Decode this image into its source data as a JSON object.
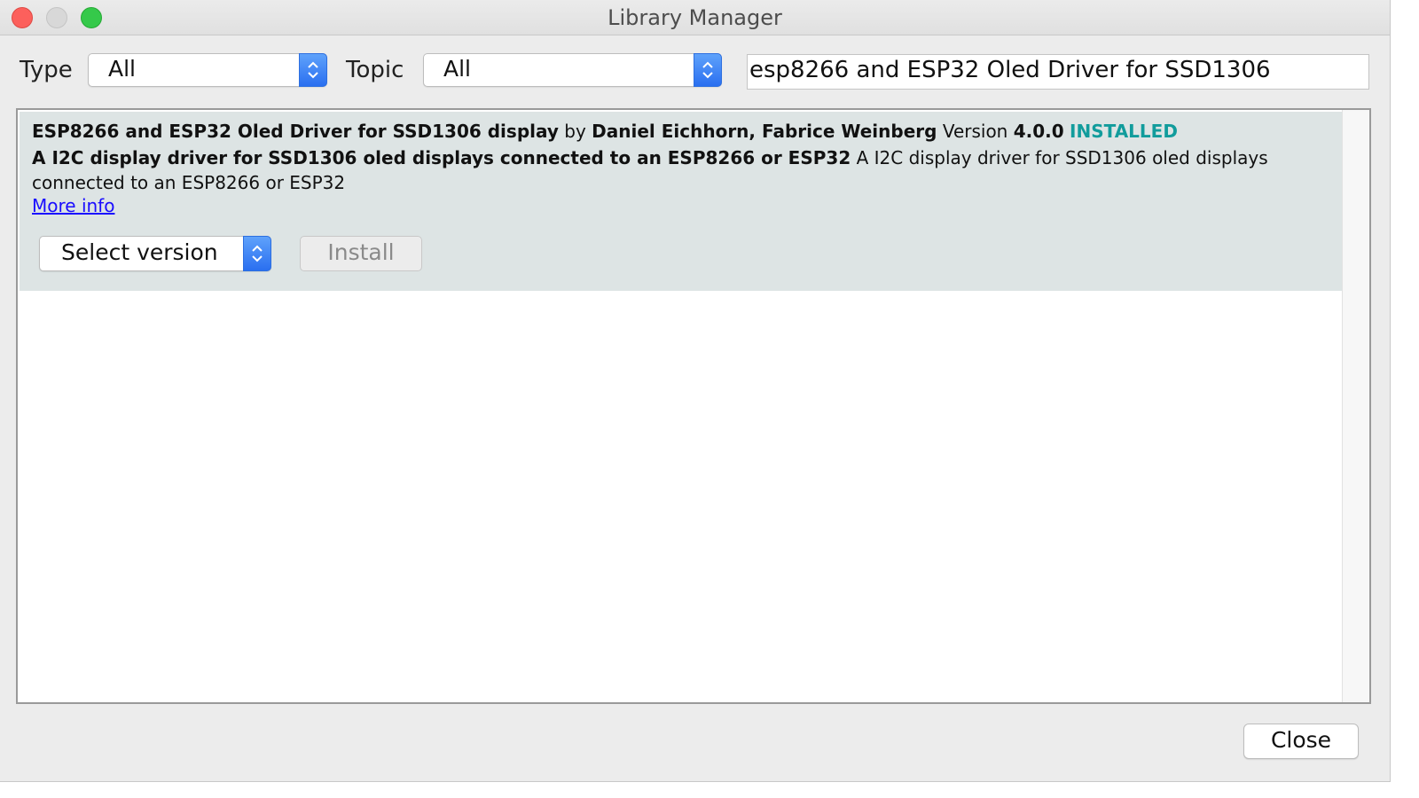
{
  "window": {
    "title": "Library Manager"
  },
  "filters": {
    "type_label": "Type",
    "type_value": "All",
    "topic_label": "Topic",
    "topic_value": "All",
    "search_value": "esp8266 and ESP32 Oled Driver for SSD1306"
  },
  "library": {
    "name": "ESP8266 and ESP32 Oled Driver for SSD1306 display",
    "by_label": "by",
    "authors": "Daniel Eichhorn, Fabrice Weinberg",
    "version_label": "Version",
    "version": "4.0.0",
    "status": "INSTALLED",
    "summary": "A I2C display driver for SSD1306 oled displays connected to an ESP8266 or ESP32",
    "description": "A I2C display driver for SSD1306 oled displays connected to an ESP8266 or ESP32",
    "more_info": "More info",
    "select_version": "Select version",
    "install_label": "Install"
  },
  "footer": {
    "close_label": "Close"
  },
  "colors": {
    "installed": "#119c9c",
    "link": "#1a0dff",
    "stepper": "#2a6ff0",
    "item_bg": "#dde4e4"
  },
  "icons": {
    "stepper": "chevron-up-down-icon"
  }
}
